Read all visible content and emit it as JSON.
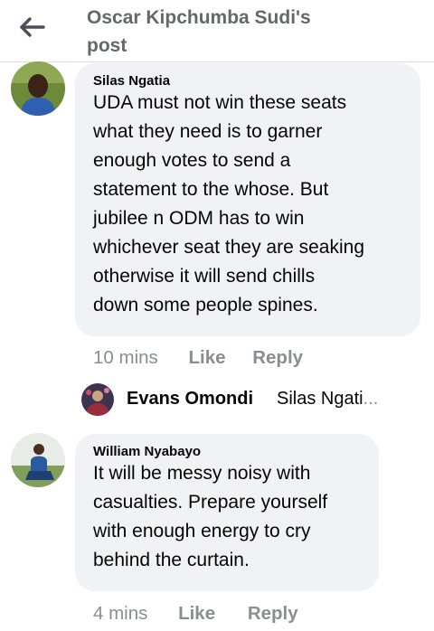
{
  "header": {
    "title_line1": "Oscar Kipchumba Sudi's",
    "title_line2": "post",
    "back_icon": "back-arrow-icon"
  },
  "comments": [
    {
      "author": "Silas Ngatia",
      "lines": [
        "UDA must not win these seats",
        "what they need is to garner",
        "enough votes to send a",
        "statement to the whose. But",
        "jubilee n ODM has to win",
        "whichever seat they are seaking",
        "otherwise it will send chills",
        "down some people spines."
      ],
      "time": "10 mins",
      "like_label": "Like",
      "reply_label": "Reply"
    },
    {
      "author": "William Nyabayo",
      "lines": [
        "It will be messy noisy with",
        "casualties. Prepare yourself",
        "with enough energy to cry",
        "behind the curtain."
      ],
      "time": "4 mins",
      "like_label": "Like",
      "reply_label": "Reply"
    }
  ],
  "reply_preview": {
    "author": "Evans Omondi",
    "text": "Silas Ngati",
    "ellipsis": "..."
  },
  "colors": {
    "bubble": "#f0f2f5",
    "meta_text": "#8a8d91",
    "header_text": "#65676b"
  }
}
